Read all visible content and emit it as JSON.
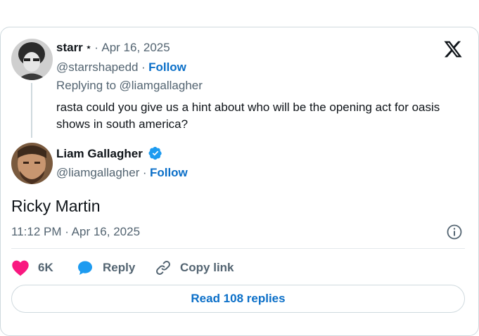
{
  "reply_tweet": {
    "display_name": "starr",
    "name_suffix": "⋆",
    "dot": "·",
    "date": "Apr 16, 2025",
    "handle": "@starrshapedd",
    "follow_label": "Follow",
    "replying_to_prefix": "Replying to",
    "replying_to_handle": "@liamgallagher",
    "text": "rasta could you give us a hint about who will be the opening act for oasis shows in south america?"
  },
  "main_tweet": {
    "display_name": "Liam Gallagher",
    "handle": "@liamgallagher",
    "follow_label": "Follow",
    "text": "Ricky Martin",
    "timestamp": "11:12 PM · Apr 16, 2025"
  },
  "actions": {
    "like_count": "6K",
    "reply_label": "Reply",
    "copy_link_label": "Copy link"
  },
  "read_replies_label": "Read 108 replies",
  "icons": {
    "logo": "x-logo-icon",
    "verified": "verified-badge-icon",
    "info": "info-icon",
    "like": "heart-icon",
    "reply": "reply-bubble-icon",
    "copy": "link-icon"
  },
  "colors": {
    "link_blue": "#0b6fc8",
    "verified_blue": "#1d9bf0",
    "like_pink": "#f91880",
    "muted_text": "#536471"
  }
}
